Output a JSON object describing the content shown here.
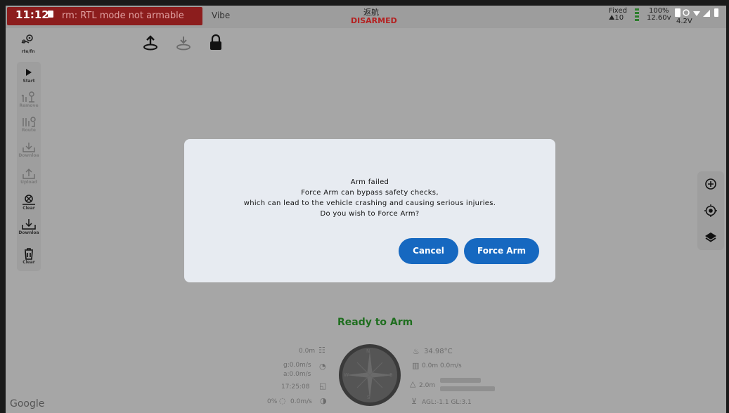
{
  "statusbar": {
    "time": "11:12",
    "alert": "rm: RTL mode not armable",
    "vibe": "Vibe",
    "flight_mode": "返航",
    "arm_state": "DISARMED",
    "gps_fix": "Fixed",
    "gps_sats": "⛰10",
    "battery_percent": "100%",
    "battery_voltage": "12.60v",
    "phone_voltage": "4.2V"
  },
  "toolbar": {
    "rtl_label": "rte/fn"
  },
  "sidebar": {
    "items": [
      {
        "label": "Start",
        "icon": "play-icon"
      },
      {
        "label": "Remove",
        "icon": "remove-waypoints-icon"
      },
      {
        "label": "Route",
        "icon": "route-icon"
      },
      {
        "label": "Downloa",
        "icon": "download-icon"
      },
      {
        "label": "Upload",
        "icon": "upload-icon"
      },
      {
        "label": "Clear",
        "icon": "clear-icon"
      },
      {
        "label": "Downloa",
        "icon": "download-icon"
      },
      {
        "label": "Clear",
        "icon": "trash-icon"
      }
    ]
  },
  "dialog": {
    "title": "Arm failed",
    "line1": "Force Arm can bypass safety checks,",
    "line2": "which can lead to the vehicle crashing and causing serious injuries.",
    "line3": "Do you wish to Force Arm?",
    "cancel_label": "Cancel",
    "force_label": "Force Arm"
  },
  "hud": {
    "ready_text": "Ready to Arm",
    "distance": "0.0m",
    "ground_speed": "g:0.0m/s",
    "air_speed": "a:0.0m/s",
    "flight_time": "17:25:08",
    "throttle": "0%",
    "vertical_speed": "0.0m/s",
    "temperature": "34.98°C",
    "wind": "0.0m 0.0m/s",
    "altitude": "2.0m",
    "agl": "AGL:-1.1 GL:3.1",
    "compass_n": "N",
    "compass_s": "S",
    "compass_e": "E",
    "compass_w": "W"
  },
  "map": {
    "attribution": "Google"
  },
  "colors": {
    "accent": "#1668c0",
    "alert": "#8c1d1d",
    "disarmed": "#b42020",
    "ready": "#1f6e1f"
  }
}
